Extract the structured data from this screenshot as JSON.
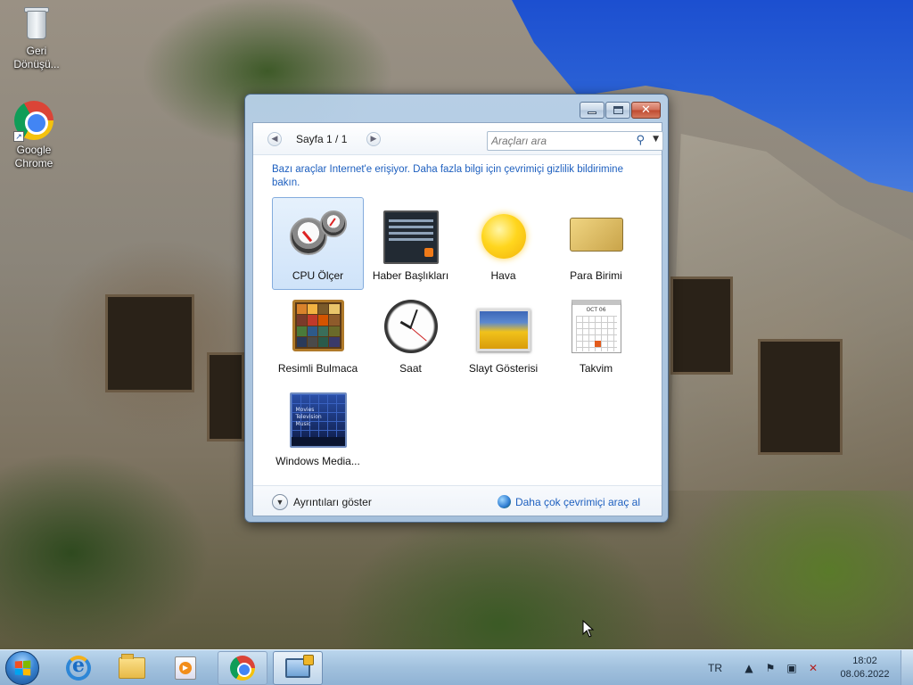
{
  "desktop": {
    "icons": [
      {
        "label": "Geri Dönüşü...",
        "icon": "recycle-bin-icon"
      },
      {
        "label": "Google Chrome",
        "icon": "chrome-icon"
      }
    ]
  },
  "gadget_window": {
    "page_label": "Sayfa 1 / 1",
    "search": {
      "placeholder": "Araçları ara",
      "value": ""
    },
    "info_text": "Bazı araçlar Internet'e erişiyor. Daha fazla bilgi için çevrimiçi gizlilik bildirimine bakın.",
    "gadgets": [
      {
        "label": "CPU Ölçer",
        "icon": "cpu-meter-icon",
        "selected": true
      },
      {
        "label": "Haber Başlıkları",
        "icon": "feed-headlines-icon"
      },
      {
        "label": "Hava",
        "icon": "weather-sun-icon"
      },
      {
        "label": "Para Birimi",
        "icon": "currency-icon"
      },
      {
        "label": "Resimli Bulmaca",
        "icon": "picture-puzzle-icon"
      },
      {
        "label": "Saat",
        "icon": "clock-icon"
      },
      {
        "label": "Slayt Gösterisi",
        "icon": "slideshow-icon"
      },
      {
        "label": "Takvim",
        "icon": "calendar-icon"
      },
      {
        "label": "Windows Media...",
        "icon": "windows-media-center-icon"
      }
    ],
    "details_label": "Ayrıntıları göster",
    "online_link": "Daha çok çevrimiçi araç al",
    "calendar_month": "OCT 06",
    "wmc_lines": [
      "Movies",
      "Television",
      "Music"
    ]
  },
  "taskbar": {
    "pinned": [
      "internet-explorer-icon",
      "folder-icon",
      "media-player-icon",
      "chrome-icon",
      "gadgets-icon"
    ],
    "language": "TR",
    "time": "18:02",
    "date": "08.06.2022"
  }
}
